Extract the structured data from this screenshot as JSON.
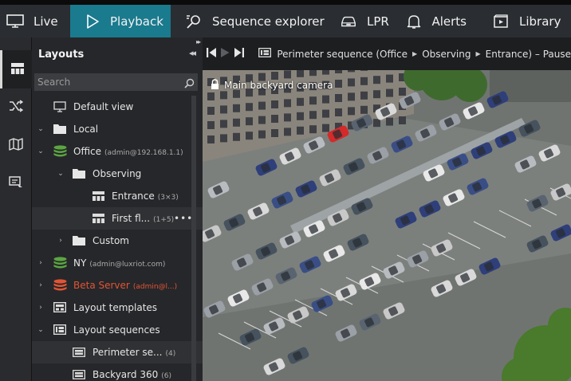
{
  "nav": {
    "tabs": [
      {
        "label": "Live",
        "icon": "monitor-icon"
      },
      {
        "label": "Playback",
        "icon": "play-icon",
        "active": true
      },
      {
        "label": "Sequence explorer",
        "icon": "sequence-search-icon"
      },
      {
        "label": "LPR",
        "icon": "car-icon"
      },
      {
        "label": "Alerts",
        "icon": "bell-icon"
      },
      {
        "label": "Library",
        "icon": "library-icon"
      }
    ],
    "active_color": "#1a7a8e"
  },
  "panel": {
    "title": "Layouts",
    "search_placeholder": "Search"
  },
  "tree": [
    {
      "label": "Default view",
      "icon": "monitor-icon"
    },
    {
      "label": "Local",
      "icon": "folder-icon",
      "expanded": true
    },
    {
      "label": "Office",
      "sub": "(admin@192.168.1.1)",
      "icon": "server-stack-icon",
      "expanded": true
    },
    {
      "label": "Observing",
      "icon": "folder-icon",
      "expanded": true
    },
    {
      "label": "Entrance",
      "sub": "(3×3)",
      "icon": "layout-grid-icon"
    },
    {
      "label": "First fl...",
      "sub": "(1+5)",
      "icon": "layout-grid-icon",
      "more": "•••"
    },
    {
      "label": "Custom",
      "icon": "folder-icon"
    },
    {
      "label": "NY",
      "sub": "(admin@luxriot.com)",
      "icon": "server-stack-icon"
    },
    {
      "label": "Beta Server",
      "sub": "(admin@l...)",
      "icon": "server-stack-red-icon"
    },
    {
      "label": "Layout templates",
      "icon": "layout-templates-icon"
    },
    {
      "label": "Layout sequences",
      "icon": "layout-sequences-icon",
      "expanded": true
    },
    {
      "label": "Perimeter se...",
      "sub": "(4)",
      "icon": "sequence-icon"
    },
    {
      "label": "Backyard 360",
      "sub": "(6)",
      "icon": "sequence-icon"
    }
  ],
  "toolbar": {
    "breadcrumb": [
      "Perimeter sequence (Office",
      "Observing",
      "Entrance) – Pause"
    ]
  },
  "camera": {
    "name": "Main backyard camera"
  },
  "colors": {
    "server_green": "#5ba642",
    "server_red": "#e05535"
  }
}
